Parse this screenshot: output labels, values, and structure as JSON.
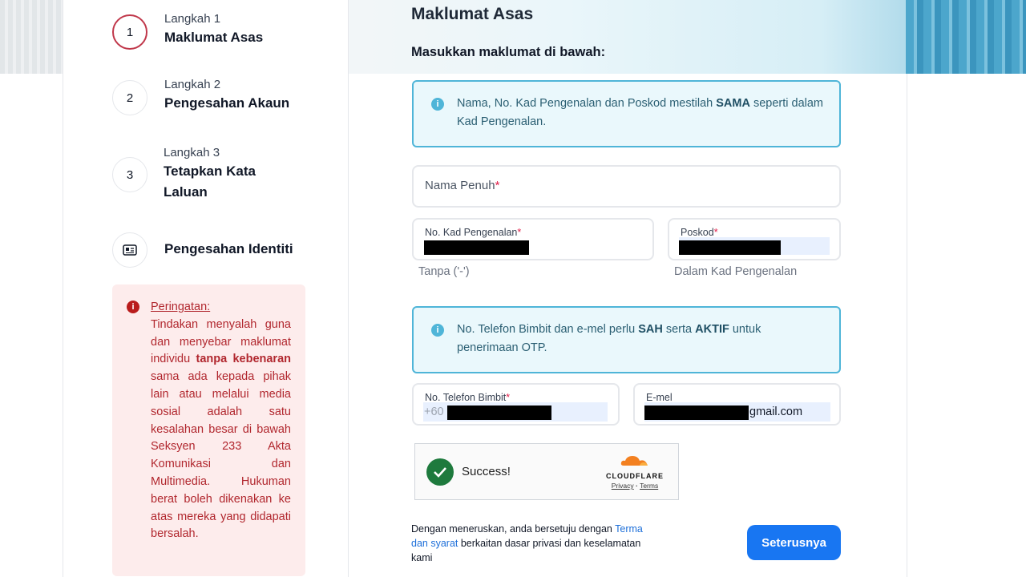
{
  "stepper": {
    "steps": [
      {
        "number": "1",
        "sub": "Langkah 1",
        "title": "Maklumat Asas"
      },
      {
        "number": "2",
        "sub": "Langkah 2",
        "title": "Pengesahan Akaun"
      },
      {
        "number": "3",
        "sub": "Langkah 3",
        "title_line1": "Tetapkan Kata",
        "title_line2": "Laluan"
      },
      {
        "icon": "id-card-icon",
        "title": "Pengesahan Identiti"
      }
    ]
  },
  "warning": {
    "title": "Peringatan:",
    "text_before": "Tindakan menyalah guna dan menyebar maklumat individu ",
    "bold": "tanpa kebenaran",
    "text_after": " sama ada kepada pihak lain atau melalui media sosial adalah satu kesalahan besar di bawah Seksyen 233 Akta Komunikasi dan Multimedia. Hukuman berat boleh dikenakan ke atas mereka yang didapati bersalah."
  },
  "form": {
    "title": "Maklumat Asas",
    "subtitle": "Masukkan maklumat di bawah:",
    "info1": {
      "before": "Nama, No. Kad Pengenalan dan Poskod mestilah ",
      "bold": "SAMA",
      "after": " seperti dalam Kad Pengenalan."
    },
    "full_name_label": "Nama Penuh",
    "ic_label": "No. Kad Pengenalan",
    "ic_hint": "Tanpa ('-')",
    "postcode_label": "Poskod",
    "postcode_hint": "Dalam Kad Pengenalan",
    "info2": {
      "before": "No. Telefon Bimbit dan e-mel perlu ",
      "bold1": "SAH",
      "mid": " serta ",
      "bold2": "AKTIF",
      "after": " untuk penerimaan OTP."
    },
    "phone_label": "No. Telefon Bimbit",
    "phone_prefix": "+60",
    "email_label": "E-mel",
    "email_suffix": "gmail.com",
    "required_mark": "*"
  },
  "captcha": {
    "status": "Success!",
    "brand": "CLOUDFLARE",
    "privacy": "Privacy",
    "dot": "·",
    "terms": "Terms"
  },
  "footer": {
    "agree_before": "Dengan meneruskan, anda bersetuju dengan ",
    "agree_link": "Terma dan syarat",
    "agree_after": " berkaitan dasar privasi dan keselamatan kami",
    "next_button": "Seterusnya"
  },
  "colors": {
    "accent": "#1876f2",
    "step_active": "#c0374a",
    "info_border": "#4fb5d8",
    "warning_text": "#b1272e"
  }
}
